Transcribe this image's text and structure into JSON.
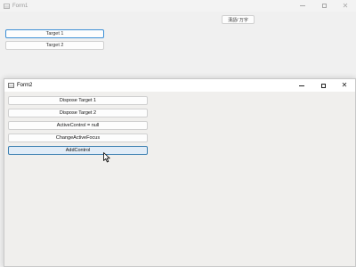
{
  "form1": {
    "title": "Form1",
    "buttons": {
      "target1": "Target 1",
      "target2": "Target 2",
      "language": "漢語/ 万字"
    }
  },
  "form2": {
    "title": "Form2",
    "buttons": {
      "dispose_target1": "Dispose Target 1",
      "dispose_target2": "Dispose Target 2",
      "active_control_null": "ActiveControl = null",
      "change_active_focus": "ChangeActiveFocus",
      "add_control": "AddControl"
    }
  },
  "caption": {
    "minimize_glyph": "",
    "close_glyph": "✕"
  },
  "colors": {
    "hover_button_bg": "#e1ecf7",
    "hover_button_border": "#3c7fb1",
    "focus_border": "#3c8fd6"
  }
}
